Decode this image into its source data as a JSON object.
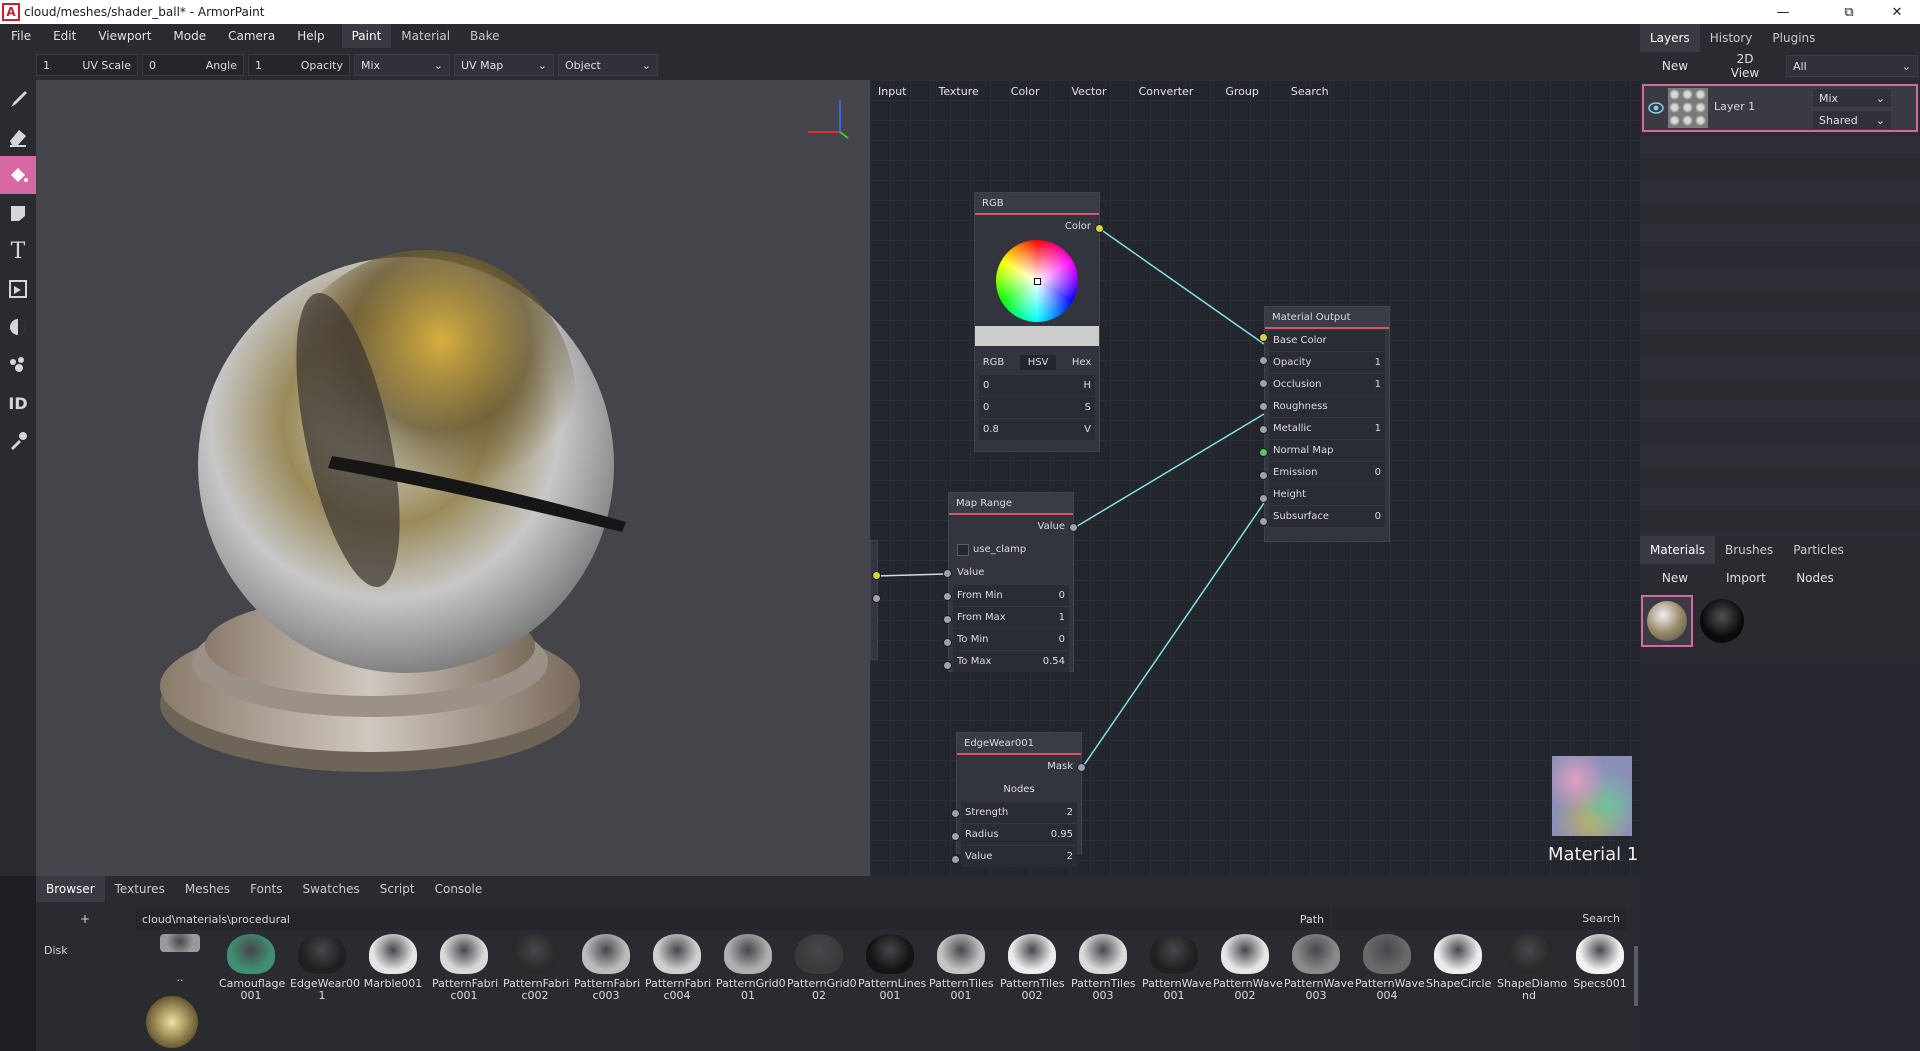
{
  "window": {
    "title": "cloud/meshes/shader_ball* - ArmorPaint",
    "logo_letter": "A",
    "min_icon": "—",
    "max_icon": "⧉",
    "close_icon": "✕"
  },
  "menu": [
    "File",
    "Edit",
    "Viewport",
    "Mode",
    "Camera",
    "Help"
  ],
  "mode_tabs": [
    {
      "label": "Paint",
      "active": true
    },
    {
      "label": "Material",
      "active": false
    },
    {
      "label": "Bake",
      "active": false
    }
  ],
  "tool_options": {
    "uv_scale": {
      "value": "1",
      "label": "UV Scale"
    },
    "angle": {
      "value": "0",
      "label": "Angle"
    },
    "opacity": {
      "value": "1",
      "label": "Opacity"
    },
    "blend": "Mix",
    "uv_map": "UV Map",
    "object": "Object",
    "dropdown_arrow": "⌄"
  },
  "tools": [
    "brush-icon",
    "eraser-icon",
    "fill-icon",
    "decal-icon",
    "text-icon",
    "clone-icon",
    "blur-icon",
    "particle-icon",
    "colorid-icon",
    "picker-icon"
  ],
  "tool_text_glyph": "T",
  "tool_colorid_glyph": "ID",
  "node_menu": [
    "Input",
    "Texture",
    "Color",
    "Vector",
    "Converter",
    "Group",
    "Search"
  ],
  "nodes": {
    "rgb": {
      "title": "RGB",
      "output": "Color",
      "tabs": [
        "RGB",
        "HSV",
        "Hex"
      ],
      "fields": [
        {
          "value": "0",
          "label": "H"
        },
        {
          "value": "0",
          "label": "S"
        },
        {
          "value": "0.8",
          "label": "V"
        }
      ]
    },
    "material_output": {
      "title": "Material Output",
      "inputs": [
        {
          "label": "Base Color",
          "value": ""
        },
        {
          "label": "Opacity",
          "value": "1"
        },
        {
          "label": "Occlusion",
          "value": "1"
        },
        {
          "label": "Roughness",
          "value": ""
        },
        {
          "label": "Metallic",
          "value": "1"
        },
        {
          "label": "Normal Map",
          "value": ""
        },
        {
          "label": "Emission",
          "value": "0"
        },
        {
          "label": "Height",
          "value": ""
        },
        {
          "label": "Subsurface",
          "value": "0"
        }
      ]
    },
    "map_range": {
      "title": "Map Range",
      "output": "Value",
      "checkbox": "use_clamp",
      "input": "Value",
      "fields": [
        {
          "label": "From Min",
          "value": "0"
        },
        {
          "label": "From Max",
          "value": "1"
        },
        {
          "label": "To Min",
          "value": "0"
        },
        {
          "label": "To Max",
          "value": "0.54"
        }
      ]
    },
    "edgewear": {
      "title": "EdgeWear001",
      "output": "Mask",
      "button": "Nodes",
      "fields": [
        {
          "label": "Strength",
          "value": "2"
        },
        {
          "label": "Radius",
          "value": "0.95"
        },
        {
          "label": "Value",
          "value": "2"
        }
      ]
    }
  },
  "material_preview_label": "Material 1",
  "right_tabs": [
    {
      "label": "Layers",
      "active": true
    },
    {
      "label": "History",
      "active": false
    },
    {
      "label": "Plugins",
      "active": false
    }
  ],
  "layers_buttons": {
    "new": "New",
    "view2d": "2D View",
    "filter": "All"
  },
  "layer": {
    "name": "Layer 1",
    "blend": "Mix",
    "scope": "Shared"
  },
  "mat_tabs": [
    {
      "label": "Materials",
      "active": true
    },
    {
      "label": "Brushes",
      "active": false
    },
    {
      "label": "Particles",
      "active": false
    }
  ],
  "mat_buttons": {
    "new": "New",
    "import": "Import",
    "nodes": "Nodes"
  },
  "bottom_tabs": [
    {
      "label": "Browser",
      "active": true
    },
    {
      "label": "Textures"
    },
    {
      "label": "Meshes"
    },
    {
      "label": "Fonts"
    },
    {
      "label": "Swatches"
    },
    {
      "label": "Script"
    },
    {
      "label": "Console"
    }
  ],
  "browser": {
    "add": "+",
    "disk": "Disk",
    "path": "cloud\\materials\\procedural",
    "path_label": "Path",
    "search": "Search",
    "items": [
      {
        "name": "..",
        "color": "#9a9a9a"
      },
      {
        "name": "Camouflage 001",
        "color": "#3f8f72"
      },
      {
        "name": "EdgeWear00 1",
        "color": "#202020"
      },
      {
        "name": "Marble001",
        "color": "#e4e4e4"
      },
      {
        "name": "PatternFabri c001",
        "color": "#d8d8d8"
      },
      {
        "name": "PatternFabri c002",
        "color": "#2a2a2a"
      },
      {
        "name": "PatternFabri c003",
        "color": "#bcbcbc"
      },
      {
        "name": "PatternFabri c004",
        "color": "#cfcfcf"
      },
      {
        "name": "PatternGrid0 01",
        "color": "#b0b0b0"
      },
      {
        "name": "PatternGrid0 02",
        "color": "#3a3a3a"
      },
      {
        "name": "PatternLines 001",
        "color": "#141414"
      },
      {
        "name": "PatternTiles 001",
        "color": "#c4c4c4"
      },
      {
        "name": "PatternTiles 002",
        "color": "#ececec"
      },
      {
        "name": "PatternTiles 003",
        "color": "#dadada"
      },
      {
        "name": "PatternWave 001",
        "color": "#202020"
      },
      {
        "name": "PatternWave 002",
        "color": "#e6e6e6"
      },
      {
        "name": "PatternWave 003",
        "color": "#8a8a8a"
      },
      {
        "name": "PatternWave 004",
        "color": "#6a6a6a"
      },
      {
        "name": "ShapeCircle",
        "color": "#ececec"
      },
      {
        "name": "ShapeDiamo nd",
        "color": "#2a2a2a"
      },
      {
        "name": "Specs001",
        "color": "#f2f2f2"
      }
    ]
  },
  "colors": {
    "accent": "#d868a2",
    "link": "#7fe0ea",
    "node_header_line": "#d9536a"
  }
}
